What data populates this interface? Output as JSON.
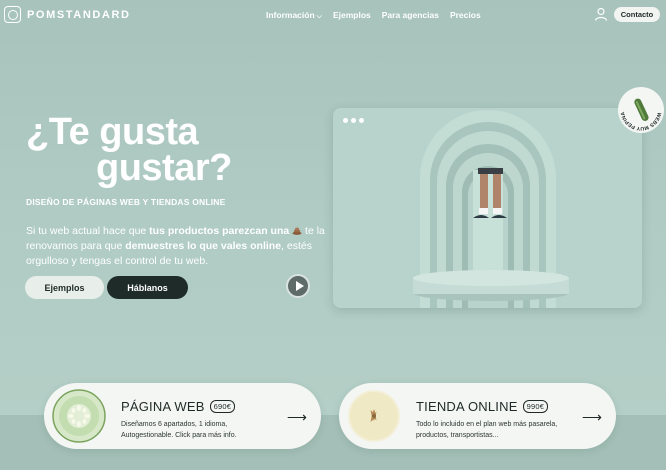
{
  "nav": {
    "logo": "POMSTANDARD",
    "links": [
      "Información",
      "Ejemplos",
      "Para agencias",
      "Precios"
    ],
    "contact": "Contacto"
  },
  "hero": {
    "title_line1": "¿Te gusta",
    "title_line2": "gustar?",
    "subtitle": "DISEÑO DE PÁGINAS WEB Y TIENDAS ONLINE",
    "desc_1": "Si tu web actual hace que ",
    "desc_bold1": "tus productos parezcan una",
    "desc_2": " te la renovamos para que ",
    "desc_bold2": "demuestres lo que vales online",
    "desc_3": ", estés orgulloso y tengas el control de tu web.",
    "btn_examples": "Ejemplos",
    "btn_talk": "Háblanos"
  },
  "badge": "WEBS MUY PEPINAS",
  "cards": {
    "web": {
      "title": "PÁGINA WEB",
      "price": "690€",
      "desc": "Diseñamos 6 apartados, 1 idioma, Autogestionable. Click para más info."
    },
    "shop": {
      "title": "TIENDA ONLINE",
      "price": "990€",
      "desc": "Todo lo incluido en el plan web más pasarela, productos, transportistas..."
    }
  },
  "colors": {
    "bg": "#a9c5bd",
    "dark": "#1e2b29",
    "card": "#f4f6f4"
  }
}
